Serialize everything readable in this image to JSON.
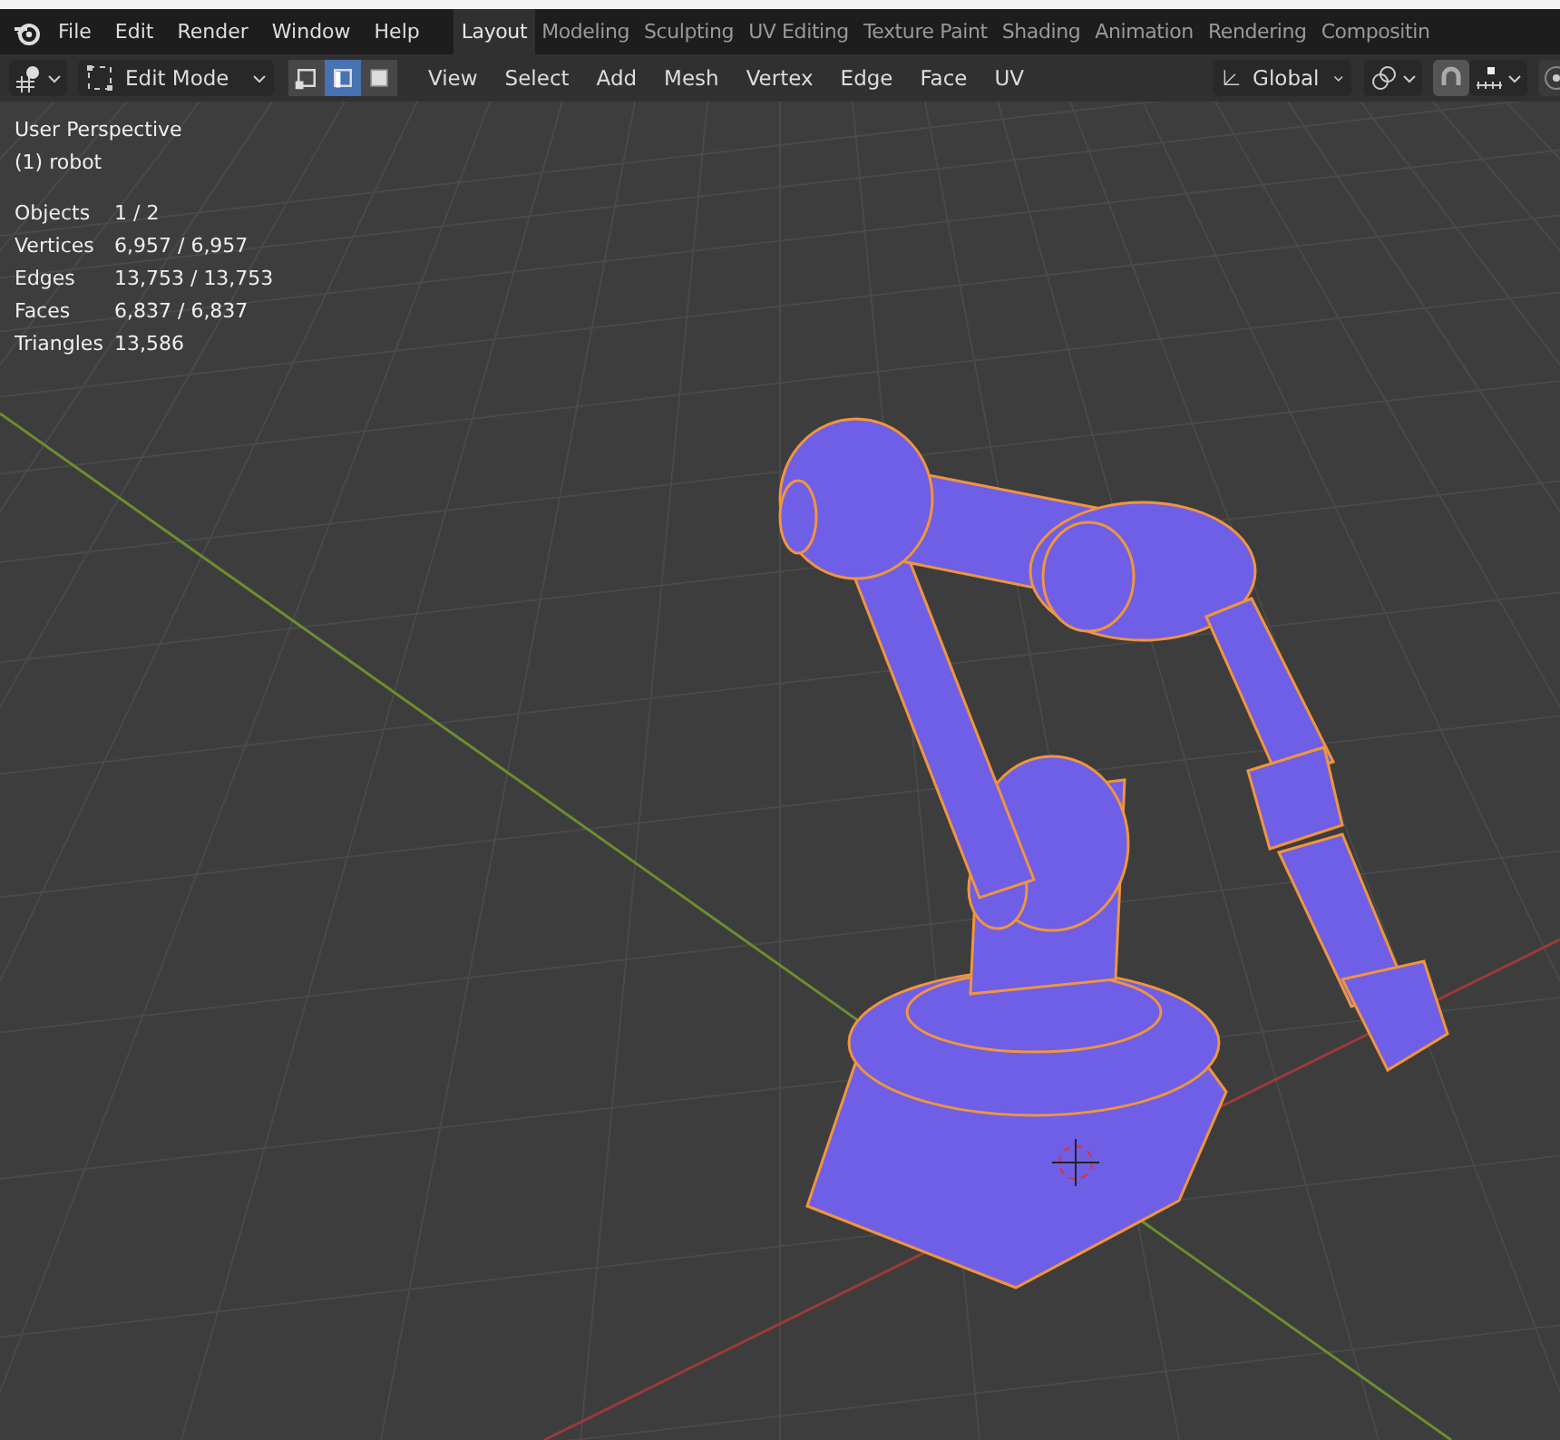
{
  "topbar": {
    "menu": [
      "File",
      "Edit",
      "Render",
      "Window",
      "Help"
    ],
    "workspaces": [
      {
        "label": "Layout",
        "selected": true
      },
      {
        "label": "Modeling",
        "selected": false
      },
      {
        "label": "Sculpting",
        "selected": false
      },
      {
        "label": "UV Editing",
        "selected": false
      },
      {
        "label": "Texture Paint",
        "selected": false
      },
      {
        "label": "Shading",
        "selected": false
      },
      {
        "label": "Animation",
        "selected": false
      },
      {
        "label": "Rendering",
        "selected": false
      },
      {
        "label": "Compositin",
        "selected": false
      }
    ]
  },
  "header": {
    "mode": "Edit Mode",
    "select_modes": [
      {
        "kind": "vertex",
        "selected": false
      },
      {
        "kind": "edge",
        "selected": true
      },
      {
        "kind": "face",
        "selected": false
      }
    ],
    "menus": [
      "View",
      "Select",
      "Add",
      "Mesh",
      "Vertex",
      "Edge",
      "Face",
      "UV"
    ],
    "orientation": "Global"
  },
  "viewport": {
    "view": "User Perspective",
    "object": "(1) robot",
    "stats": [
      {
        "label": "Objects",
        "value": "1 / 2"
      },
      {
        "label": "Vertices",
        "value": "6,957 / 6,957"
      },
      {
        "label": "Edges",
        "value": "13,753 / 13,753"
      },
      {
        "label": "Faces",
        "value": "6,837 / 6,837"
      },
      {
        "label": "Triangles",
        "value": "13,586"
      }
    ]
  }
}
